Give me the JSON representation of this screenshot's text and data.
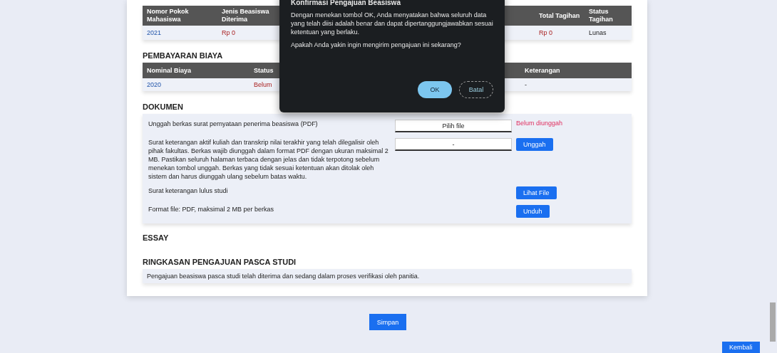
{
  "payment_table": {
    "columns": [
      {
        "label": "Nomor Pokok Mahasiswa"
      },
      {
        "label": "Jenis Beasiswa Diterima"
      },
      {
        "label": "Total Tagihan"
      },
      {
        "label": "Status Tagihan"
      }
    ],
    "rows": [
      [
        "2021",
        "Rp 0",
        "Rp 0",
        "Lunas"
      ]
    ]
  },
  "section_1": {
    "title": "PEMBAYARAN BIAYA"
  },
  "fee_table": {
    "columns": [
      {
        "label": "Nominal Biaya"
      },
      {
        "label": "Status"
      },
      {
        "label": "Keterangan"
      }
    ],
    "rows": [
      [
        "2020",
        "Belum",
        "-"
      ]
    ]
  },
  "section_2": {
    "title": "DOKUMEN"
  },
  "documents": [
    {
      "kind": "upload",
      "text": "Unggah berkas surat pernyataan penerima beasiswa (PDF)",
      "field": "Pilih file",
      "status": "Belum diunggah"
    },
    {
      "kind": "upload",
      "text": "Surat keterangan aktif kuliah dan transkrip nilai terakhir yang telah dilegalisir oleh pihak fakultas. Berkas wajib diunggah dalam format PDF dengan ukuran maksimal 2 MB. Pastikan seluruh halaman terbaca dengan jelas dan tidak terpotong sebelum menekan tombol unggah. Berkas yang tidak sesuai ketentuan akan ditolak oleh sistem dan harus diunggah ulang sebelum batas waktu.",
      "field": "-",
      "button": "Unggah"
    },
    {
      "kind": "action",
      "text": "Surat keterangan lulus studi",
      "button": "Lihat File"
    },
    {
      "kind": "action",
      "text": "Format file: PDF, maksimal 2 MB per berkas",
      "button": "Unduh"
    }
  ],
  "section_3": {
    "title": "ESSAY"
  },
  "section_4": {
    "title": "RINGKASAN PENGAJUAN PASCA STUDI",
    "text": "Pengajuan beasiswa pasca studi telah diterima dan sedang dalam proses verifikasi oleh panitia."
  },
  "submit_button": "Simpan",
  "corner_button": "Kembali",
  "dialog": {
    "title": "Konfirmasi Pengajuan Beasiswa",
    "message": "Dengan menekan tombol OK, Anda menyatakan bahwa seluruh data yang telah diisi adalah benar dan dapat dipertanggungjawabkan sesuai ketentuan yang berlaku.",
    "question": "Apakah Anda yakin ingin mengirim pengajuan ini sekarang?",
    "ok": "OK",
    "cancel": "Batal"
  }
}
